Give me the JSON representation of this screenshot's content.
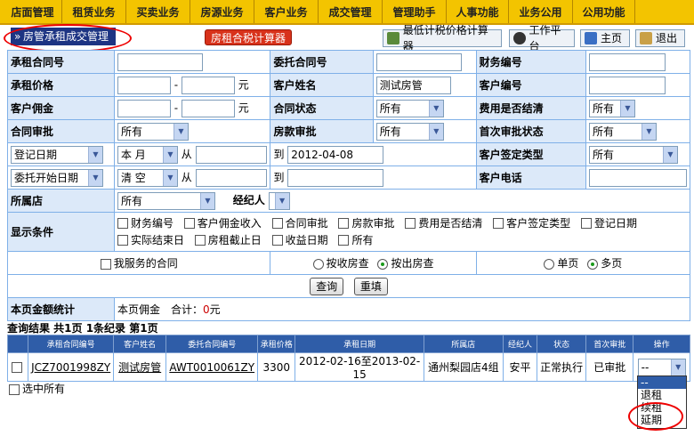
{
  "nav": [
    "店面管理",
    "租赁业务",
    "买卖业务",
    "房源业务",
    "客户业务",
    "成交管理",
    "管理助手",
    "人事功能",
    "业务公用",
    "公用功能"
  ],
  "header": {
    "page_title": "房管承租成交管理",
    "tax_calc": "房租合税计算器",
    "min_tax_calc": "最低计税价格计算器",
    "workbench": "工作平台",
    "home": "主页",
    "logout": "退出"
  },
  "form": {
    "lease_contract_no": "承租合同号",
    "entrust_contract_no": "委托合同号",
    "finance_no": "财务编号",
    "lease_price": "承租价格",
    "dash": "-",
    "yuan": "元",
    "customer_name": "客户姓名",
    "customer_name_value": "测试房管",
    "customer_no": "客户编号",
    "customer_commission": "客户佣金",
    "contract_status": "合同状态",
    "contract_status_value": "所有",
    "fee_settled": "费用是否结清",
    "fee_settled_value": "所有",
    "contract_review": "合同审批",
    "contract_review_value": "所有",
    "payment_review": "房款审批",
    "payment_review_value": "所有",
    "first_review_status": "首次审批状态",
    "first_review_status_value": "所有",
    "register_date": "登记日期",
    "period_value": "本 月",
    "from": "从",
    "to": "到",
    "to_date_value": "2012-04-08",
    "customer_sign_type": "客户签定类型",
    "customer_sign_type_value": "所有",
    "entrust_start_date": "委托开始日期",
    "clear_value": "清 空",
    "customer_phone": "客户电话",
    "store": "所属店",
    "store_value": "所有",
    "agent": "经纪人",
    "display_conditions": "显示条件",
    "checkboxes": [
      "财务编号",
      "客户佣金收入",
      "合同审批",
      "房款审批",
      "费用是否结清",
      "客户签定类型",
      "登记日期",
      "实际结束日",
      "房租截止日",
      "收益日期",
      "所有"
    ],
    "my_contracts": "我服务的合同",
    "by_receive": "按收房查",
    "by_out": "按出房查",
    "single_page": "单页",
    "multi_page": "多页",
    "query_btn": "查询",
    "reset_btn": "重填",
    "page_total_label": "本页金额统计",
    "page_total_text": "本页佣金　合计：",
    "page_total_value": "0",
    "page_total_unit": "元"
  },
  "results": {
    "summary": "查询结果 共1页 1条纪录 第1页",
    "columns": [
      "承租合同编号",
      "客户姓名",
      "委托合同编号",
      "承租价格",
      "承租日期",
      "所属店",
      "经纪人",
      "状态",
      "首次审批",
      "操作"
    ],
    "rows": [
      {
        "lease_no": "JCZ7001998ZY",
        "customer": "测试房管",
        "entrust_no": "AWT0010061ZY",
        "price": "3300",
        "dates": "2012-02-16至2013-02-15",
        "store": "通州梨园店4组",
        "agent": "安平",
        "status": "正常执行",
        "first_review": "已审批",
        "op_value": "--"
      }
    ],
    "op_options": [
      "--",
      "退租",
      "续租",
      "延期"
    ],
    "select_all": "选中所有"
  }
}
